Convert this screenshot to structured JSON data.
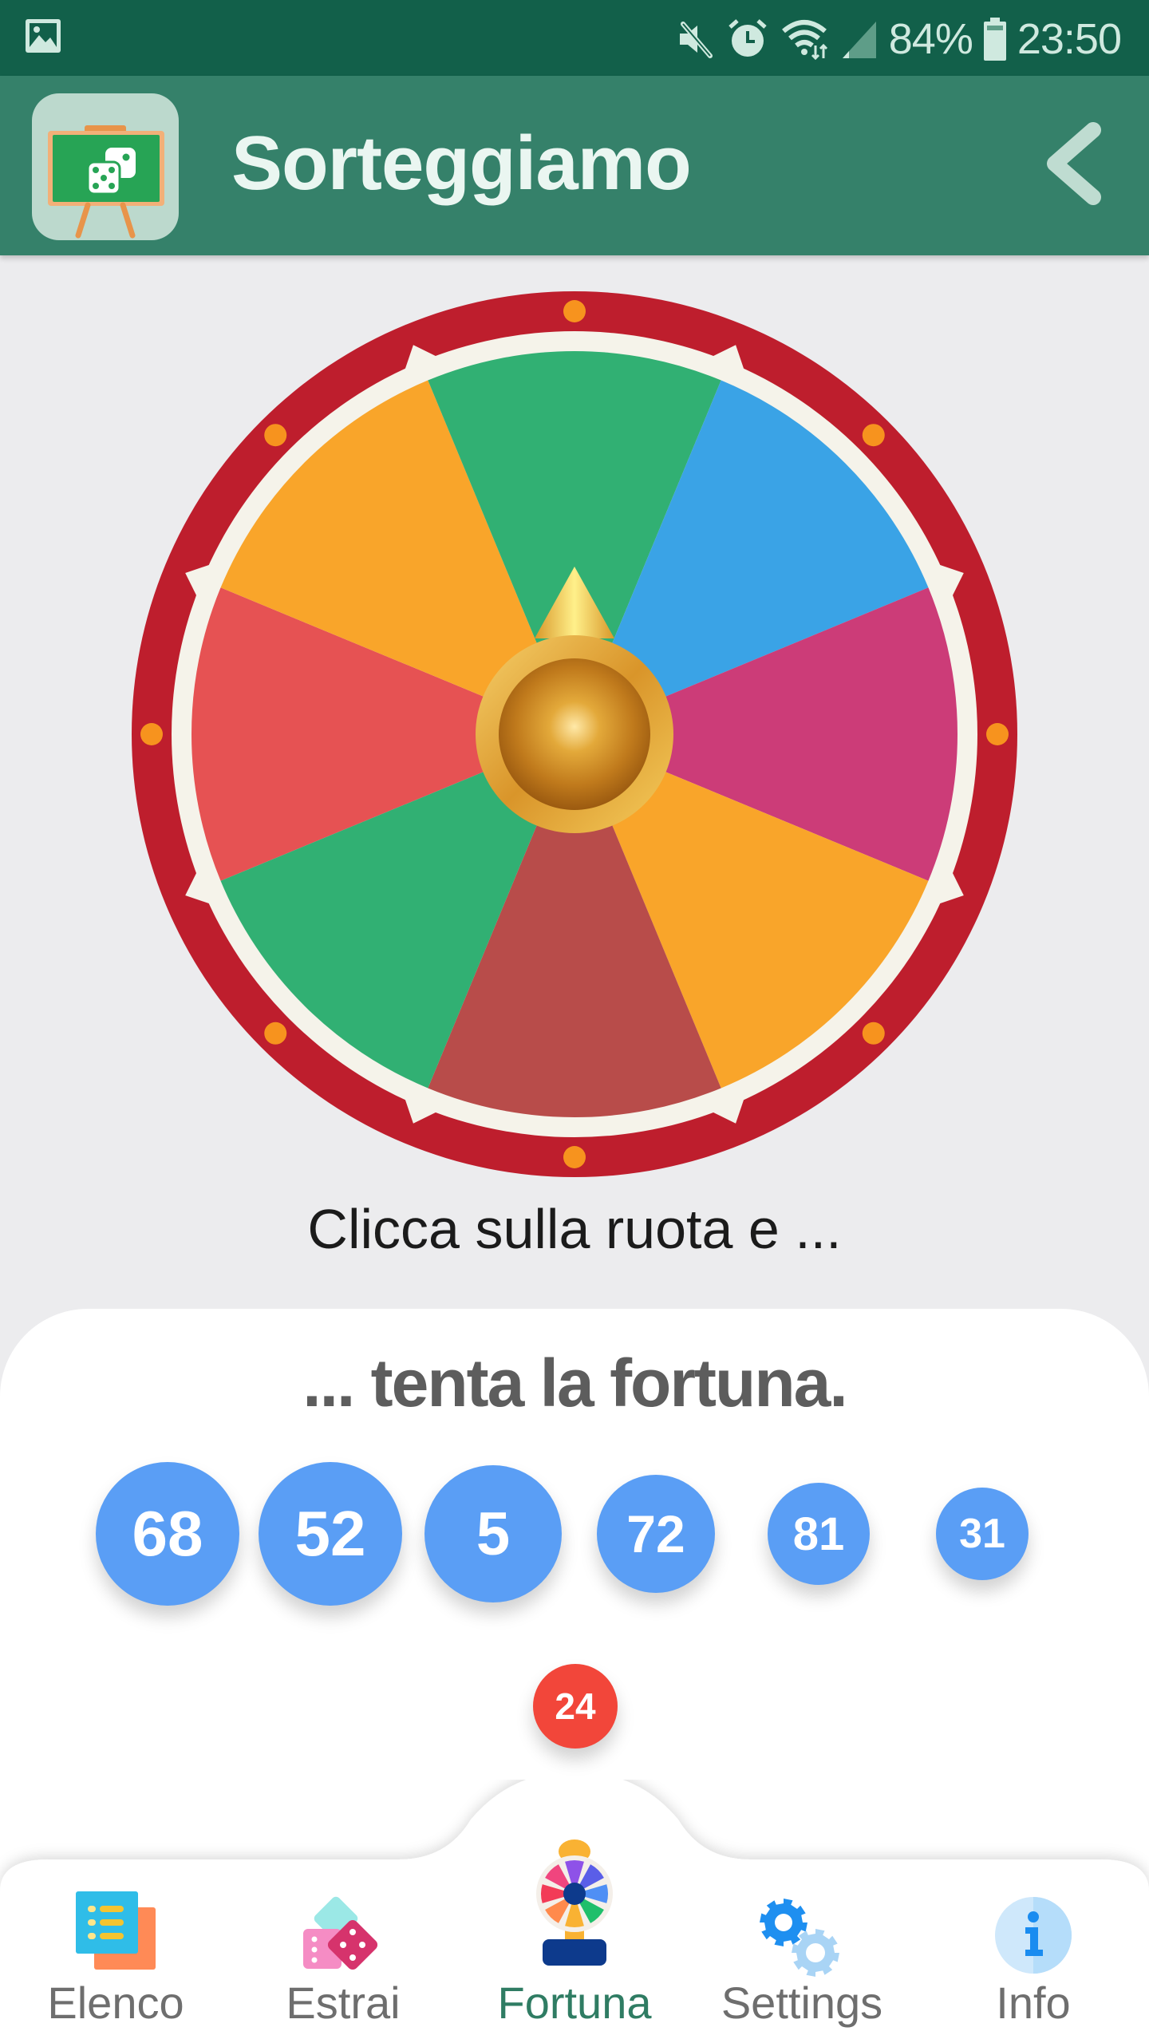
{
  "status_bar": {
    "left_icons": [
      "image-icon"
    ],
    "right_icons": [
      "mute-icon",
      "alarm-icon",
      "wifi-icon",
      "signal-icon",
      "battery-icon"
    ],
    "battery": "84%",
    "time": "23:50"
  },
  "app_bar": {
    "title": "Sorteggiamo",
    "app_icon": "chalkboard-dice-icon",
    "back_icon": "chevron-left-icon"
  },
  "wheel": {
    "segment_colors": [
      "#e65253",
      "#f9a52a",
      "#31b073",
      "#3aa3e6",
      "#cc3c78",
      "#f9a52a",
      "#b84c4a",
      "#31b073"
    ],
    "rim_color": "#be1e2d",
    "inner_ring_color": "#f5f3ea",
    "light_color": "#f7931e",
    "hub": "gold-pointer-hub"
  },
  "prompt": "Clicca sulla ruota e ...",
  "result_card": {
    "title": "... tenta la fortuna.",
    "drawn_numbers": [
      "68",
      "52",
      "5",
      "72",
      "81",
      "31"
    ],
    "latest_number": "24",
    "colors": {
      "drawn": "#5a9ef5",
      "latest": "#f2463a"
    }
  },
  "bottom_nav": {
    "items": [
      {
        "label": "Elenco",
        "icon": "list-icon",
        "active": false
      },
      {
        "label": "Estrai",
        "icon": "dice-icon",
        "active": false
      },
      {
        "label": "Fortuna",
        "icon": "fortune-wheel-icon",
        "active": true
      },
      {
        "label": "Settings",
        "icon": "gears-icon",
        "active": false
      },
      {
        "label": "Info",
        "icon": "info-icon",
        "active": false
      }
    ],
    "active_color": "#2f7c63"
  }
}
